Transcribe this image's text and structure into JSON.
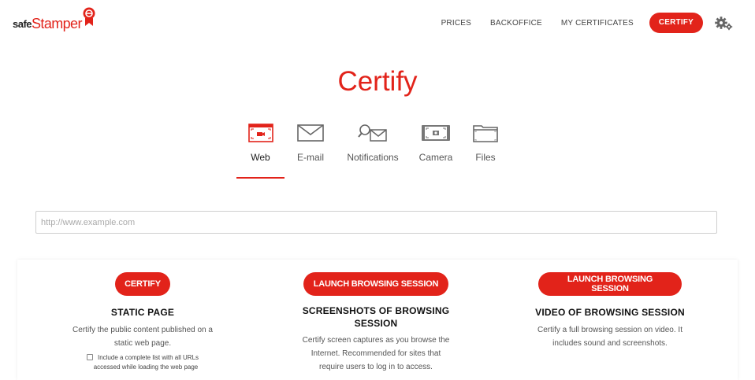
{
  "brand": {
    "safe": "safe",
    "stamper": "Stamper",
    "accent": "#e2231a"
  },
  "nav": {
    "links": [
      "PRICES",
      "BACKOFFICE",
      "MY CERTIFICATES"
    ],
    "cta": "CERTIFY",
    "settings_icon": "gear-icon"
  },
  "page": {
    "title": "Certify"
  },
  "tabs": [
    {
      "label": "Web",
      "icon": "browser-icon",
      "active": true
    },
    {
      "label": "E-mail",
      "icon": "envelope-icon",
      "active": false
    },
    {
      "label": "Notifications",
      "icon": "search-envelope-icon",
      "active": false
    },
    {
      "label": "Camera",
      "icon": "camera-icon",
      "active": false
    },
    {
      "label": "Files",
      "icon": "folder-icon",
      "active": false
    }
  ],
  "url_input": {
    "placeholder": "http://www.example.com",
    "value": ""
  },
  "options": [
    {
      "button": "CERTIFY",
      "title": "STATIC PAGE",
      "description_lines": [
        "Certify the public content published on a",
        "static web page."
      ],
      "checkbox_lines": [
        "Include a complete list with all URLs",
        "accessed while loading the web page"
      ]
    },
    {
      "button": "LAUNCH BROWSING SESSION",
      "title_lines": [
        "SCREENSHOTS OF BROWSING",
        "SESSION"
      ],
      "description_lines": [
        "Certify screen captures as you browse the",
        "Internet. Recommended for sites that",
        "require users to log in to access."
      ]
    },
    {
      "button": "LAUNCH BROWSING SESSION",
      "title": "VIDEO OF BROWSING SESSION",
      "description_lines": [
        "Certify a full browsing session on video. It",
        "includes sound and screenshots."
      ]
    }
  ]
}
